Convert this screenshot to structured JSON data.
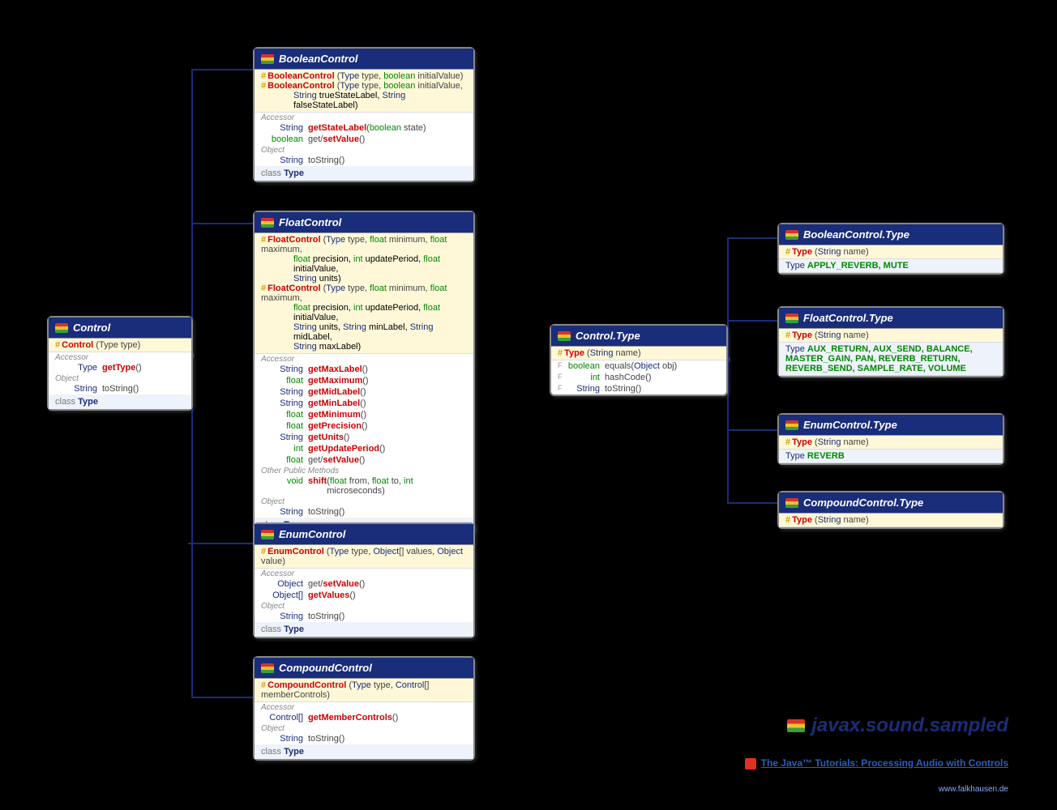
{
  "control": {
    "title": "Control",
    "ctor": "Control",
    "ctorArg": "(Type type)",
    "acc": "Accessor",
    "getType": "getType",
    "obj": "Object",
    "toString": "toString",
    "ft": "Type"
  },
  "bool": {
    "title": "BooleanControl",
    "c1": "BooleanControl",
    "c1a": "(Type type, boolean initialValue)",
    "c2": "BooleanControl",
    "c2a": "(Type type, boolean initialValue,",
    "c2b": "String trueStateLabel, String falseStateLabel)",
    "gsl": "getStateLabel",
    "gslA": "(boolean state)",
    "gsv": "get/setValue",
    "ts": "toString"
  },
  "flt": {
    "title": "FloatControl",
    "c1": "FloatControl",
    "c1a": "(Type type, float minimum, float maximum,",
    "c1b": "float precision, int updatePeriod, float initialValue,",
    "c1c": "String units)",
    "c2": "FloatControl",
    "c2a": "(Type type, float minimum, float maximum,",
    "c2b": "float precision, int updatePeriod, float initialValue,",
    "c2c": "String units, String minLabel, String midLabel,",
    "c2d": "String maxLabel)",
    "gMaxL": "getMaxLabel",
    "gMax": "getMaximum",
    "gMidL": "getMidLabel",
    "gMinL": "getMinLabel",
    "gMin": "getMinimum",
    "gPrec": "getPrecision",
    "gUnits": "getUnits",
    "gUp": "getUpdatePeriod",
    "gsv": "get/setValue",
    "opm": "Other Public Methods",
    "shift": "shift",
    "shiftA": "(float from, float to, int microseconds)",
    "ts": "toString"
  },
  "enm": {
    "title": "EnumControl",
    "c1": "EnumControl",
    "c1a": "(Type type, Object[] values, Object value)",
    "gsv": "get/setValue",
    "gv": "getValues",
    "ts": "toString"
  },
  "cmp": {
    "title": "CompoundControl",
    "c1": "CompoundControl",
    "c1a": "(Type type, Control[] memberControls)",
    "gmc": "getMemberControls",
    "ts": "toString"
  },
  "ct": {
    "title": "Control.Type",
    "c1": "Type",
    "c1a": "(String name)",
    "eq": "equals",
    "eqA": "(Object obj)",
    "hc": "hashCode",
    "ts": "toString"
  },
  "bt": {
    "title": "BooleanControl.Type",
    "c1": "Type",
    "c1a": "(String name)",
    "vals": "APPLY_REVERB, MUTE"
  },
  "ft": {
    "title": "FloatControl.Type",
    "c1": "Type",
    "c1a": "(String name)",
    "vals": "AUX_RETURN, AUX_SEND, BALANCE, MASTER_GAIN, PAN, REVERB_RETURN, REVERB_SEND, SAMPLE_RATE, VOLUME"
  },
  "et": {
    "title": "EnumControl.Type",
    "c1": "Type",
    "c1a": "(String name)",
    "vals": "REVERB"
  },
  "cpt": {
    "title": "CompoundControl.Type",
    "c1": "Type",
    "c1a": "(String name)"
  },
  "pkg": "javax.sound.sampled",
  "tut": "The Java™ Tutorials: Processing Audio with Controls",
  "wmk": "www.falkhausen.de",
  "lbls": {
    "acc": "Accessor",
    "obj": "Object",
    "cls": "class",
    "type": "Type",
    "str": "String",
    "bool": "boolean",
    "flt": "float",
    "int": "int",
    "void": "void",
    "objT": "Object",
    "objA": "Object[]",
    "ctrlA": "Control[]"
  }
}
